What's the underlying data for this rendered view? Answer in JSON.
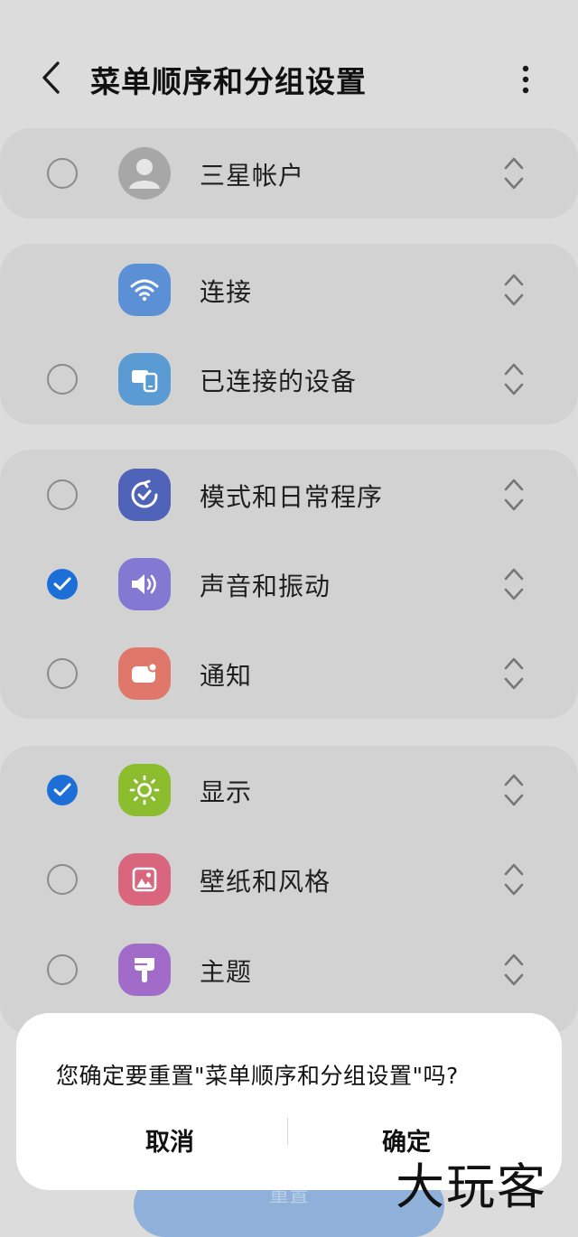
{
  "header": {
    "title": "菜单顺序和分组设置"
  },
  "groups": [
    {
      "items": [
        {
          "label": "三星帐户",
          "checked": false,
          "icon": "account-icon",
          "has_checkbox": true
        }
      ]
    },
    {
      "items": [
        {
          "label": "连接",
          "checked": false,
          "icon": "wifi-icon",
          "has_checkbox": false
        },
        {
          "label": "已连接的设备",
          "checked": false,
          "icon": "devices-icon",
          "has_checkbox": true
        }
      ]
    },
    {
      "items": [
        {
          "label": "模式和日常程序",
          "checked": false,
          "icon": "modes-icon",
          "has_checkbox": true
        },
        {
          "label": "声音和振动",
          "checked": true,
          "icon": "sound-icon",
          "has_checkbox": true
        },
        {
          "label": "通知",
          "checked": false,
          "icon": "notification-icon",
          "has_checkbox": true
        }
      ]
    },
    {
      "items": [
        {
          "label": "显示",
          "checked": true,
          "icon": "display-brightness-icon",
          "has_checkbox": true
        },
        {
          "label": "壁纸和风格",
          "checked": false,
          "icon": "wallpaper-icon",
          "has_checkbox": true
        },
        {
          "label": "主题",
          "checked": false,
          "icon": "themes-brush-icon",
          "has_checkbox": true
        }
      ]
    }
  ],
  "dialog": {
    "message": "您确定要重置\"菜单顺序和分组设置\"吗?",
    "cancel_label": "取消",
    "confirm_label": "确定"
  },
  "bottom_button": {
    "label": "重置"
  },
  "watermark": {
    "text": "大玩客"
  },
  "colors": {
    "background": "#dcdcdc",
    "group_card": "#d2d2d2",
    "check_blue": "#1c6fd6",
    "wifi_icon_bg": "#5b8fd6",
    "devices_icon_bg": "#5a9bd3",
    "modes_icon_bg": "#4f63b8",
    "sound_icon_bg": "#8478d3",
    "notification_icon_bg": "#e0776b",
    "display_icon_bg": "#8bbd2e",
    "wallpaper_icon_bg": "#d9667c",
    "themes_icon_bg": "#a16cc9"
  }
}
